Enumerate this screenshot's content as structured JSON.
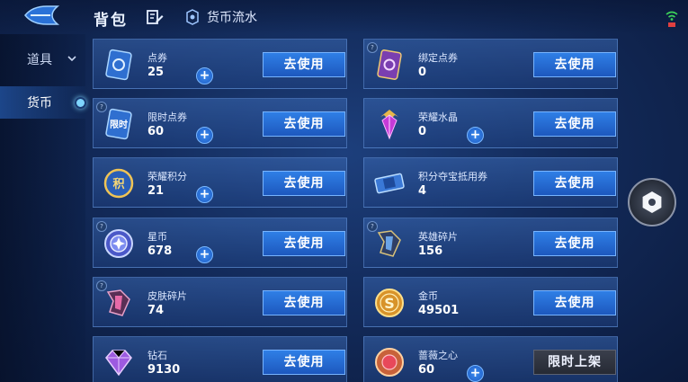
{
  "header": {
    "title": "背包",
    "flow_label": "货币流水"
  },
  "sidebar": {
    "items": [
      {
        "label": "道具"
      },
      {
        "label": "货币"
      }
    ]
  },
  "currencies": [
    {
      "name": "点券",
      "amount": "25",
      "action": "去使用",
      "icon": "coupon-icon"
    },
    {
      "name": "绑定点券",
      "amount": "0",
      "action": "去使用",
      "icon": "bound-coupon-icon"
    },
    {
      "name": "限时点券",
      "amount": "60",
      "action": "去使用",
      "icon": "limited-coupon-icon",
      "icon_text": "限时"
    },
    {
      "name": "荣耀水晶",
      "amount": "0",
      "action": "去使用",
      "icon": "glory-crystal-icon"
    },
    {
      "name": "荣耀积分",
      "amount": "21",
      "action": "去使用",
      "icon": "glory-points-icon",
      "icon_text": "积"
    },
    {
      "name": "积分夺宝抵用券",
      "amount": "4",
      "action": "去使用",
      "icon": "points-voucher-icon"
    },
    {
      "name": "星币",
      "amount": "678",
      "action": "去使用",
      "icon": "star-coin-icon"
    },
    {
      "name": "英雄碎片",
      "amount": "156",
      "action": "去使用",
      "icon": "hero-shard-icon"
    },
    {
      "name": "皮肤碎片",
      "amount": "74",
      "action": "去使用",
      "icon": "skin-shard-icon"
    },
    {
      "name": "金币",
      "amount": "49501",
      "action": "去使用",
      "icon": "gold-coin-icon",
      "icon_text": "S"
    },
    {
      "name": "钻石",
      "amount": "9130",
      "action": "去使用",
      "icon": "diamond-icon"
    },
    {
      "name": "蔷薇之心",
      "amount": "60",
      "action": "限时上架",
      "icon": "rose-heart-icon"
    }
  ],
  "colors": {
    "accent": "#2f7fe6",
    "background": "#132b5b",
    "wifi": "#3cd25a"
  }
}
